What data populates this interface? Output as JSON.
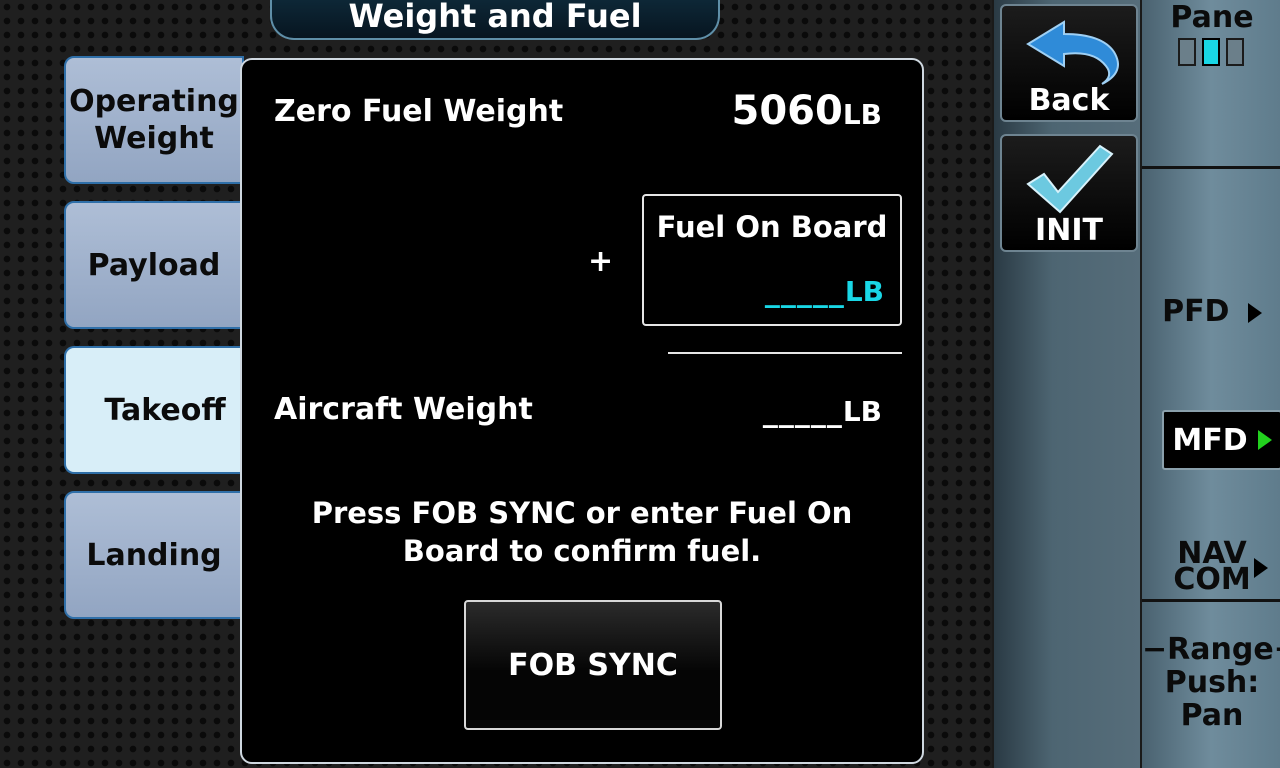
{
  "header": {
    "title": "Weight and Fuel"
  },
  "tabs": [
    {
      "label": "Operating\nWeight"
    },
    {
      "label": "Payload"
    },
    {
      "label": "Takeoff"
    },
    {
      "label": "Landing"
    }
  ],
  "panel": {
    "zero_fuel_weight": {
      "label": "Zero Fuel Weight",
      "value": "5060",
      "unit": "LB"
    },
    "plus_sign": "+",
    "fuel_on_board": {
      "label": "Fuel On Board",
      "value": "_____",
      "unit": "LB"
    },
    "aircraft_weight": {
      "label": "Aircraft Weight",
      "value": "_____",
      "unit": "LB"
    },
    "message_line1": "Press FOB SYNC or enter Fuel On",
    "message_line2": "Board to confirm fuel.",
    "fob_sync_label": "FOB SYNC"
  },
  "toolbar": {
    "back_label": "Back",
    "init_label": "INIT"
  },
  "right_keys": {
    "pane_label": "Pane",
    "pfd_label": "PFD",
    "mfd_label": "MFD",
    "nav_label": "NAV",
    "com_label": "COM",
    "range_label": "−Range+",
    "push_label": "Push:",
    "pan_label": "Pan"
  },
  "colors": {
    "cyan_entry": "#19d7e6",
    "active_arrow": "#22d11e",
    "back_arrow": "#2f8bd8",
    "check": "#6cc9e0"
  }
}
